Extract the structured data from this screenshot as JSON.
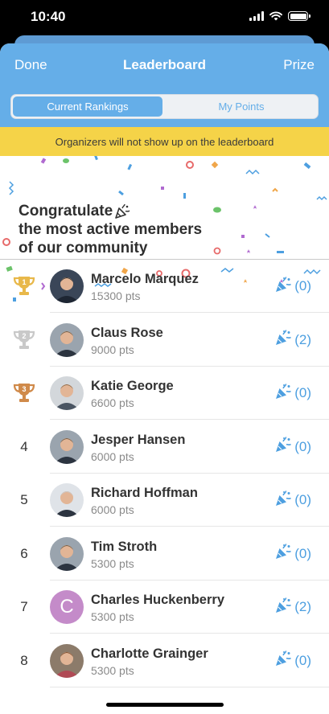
{
  "status": {
    "time": "10:40"
  },
  "header": {
    "left_label": "Done",
    "title": "Leaderboard",
    "right_label": "Prize"
  },
  "tabs": [
    {
      "label": "Current Rankings",
      "active": true
    },
    {
      "label": "My Points",
      "active": false
    }
  ],
  "banner": {
    "text": "Organizers will not show up on the leaderboard"
  },
  "hero": {
    "line1": "Congratulate",
    "line2": "the most active members",
    "line3": "of our community"
  },
  "leaderboard": [
    {
      "rank": "1",
      "trophy": "gold",
      "name": "Marcelo Marquez",
      "points": "15300 pts",
      "cheers": "(0)",
      "avatar": "photo-dark"
    },
    {
      "rank": "2",
      "trophy": "silver",
      "name": "Claus Rose",
      "points": "9000 pts",
      "cheers": "(2)",
      "avatar": "photo-suit"
    },
    {
      "rank": "3",
      "trophy": "bronze",
      "name": "Katie George",
      "points": "6600 pts",
      "cheers": "(0)",
      "avatar": "photo-badge-red"
    },
    {
      "rank": "4",
      "trophy": "",
      "name": "Jesper Hansen",
      "points": "6000 pts",
      "cheers": "(0)",
      "avatar": "photo-suit"
    },
    {
      "rank": "5",
      "trophy": "",
      "name": "Richard Hoffman",
      "points": "6000 pts",
      "cheers": "(0)",
      "avatar": "photo-badge-blue"
    },
    {
      "rank": "6",
      "trophy": "",
      "name": "Tim Stroth",
      "points": "5300 pts",
      "cheers": "(0)",
      "avatar": "photo-suit"
    },
    {
      "rank": "7",
      "trophy": "",
      "name": "Charles Huckenberry",
      "points": "5300 pts",
      "cheers": "(2)",
      "avatar": "initial",
      "initial": "C"
    },
    {
      "rank": "8",
      "trophy": "",
      "name": "Charlotte Grainger",
      "points": "5300 pts",
      "cheers": "(0)",
      "avatar": "photo-woman"
    }
  ],
  "colors": {
    "accent": "#65aee8",
    "cheer": "#4d9fe0",
    "banner": "#f5d348",
    "gold": "#e8b84a",
    "silver": "#c9c9c9",
    "bronze": "#d08a4a",
    "initial_avatar": "#c48bc9"
  },
  "icons": {
    "cheer": "party-popper-icon",
    "rank_top3": "trophy-icon"
  }
}
